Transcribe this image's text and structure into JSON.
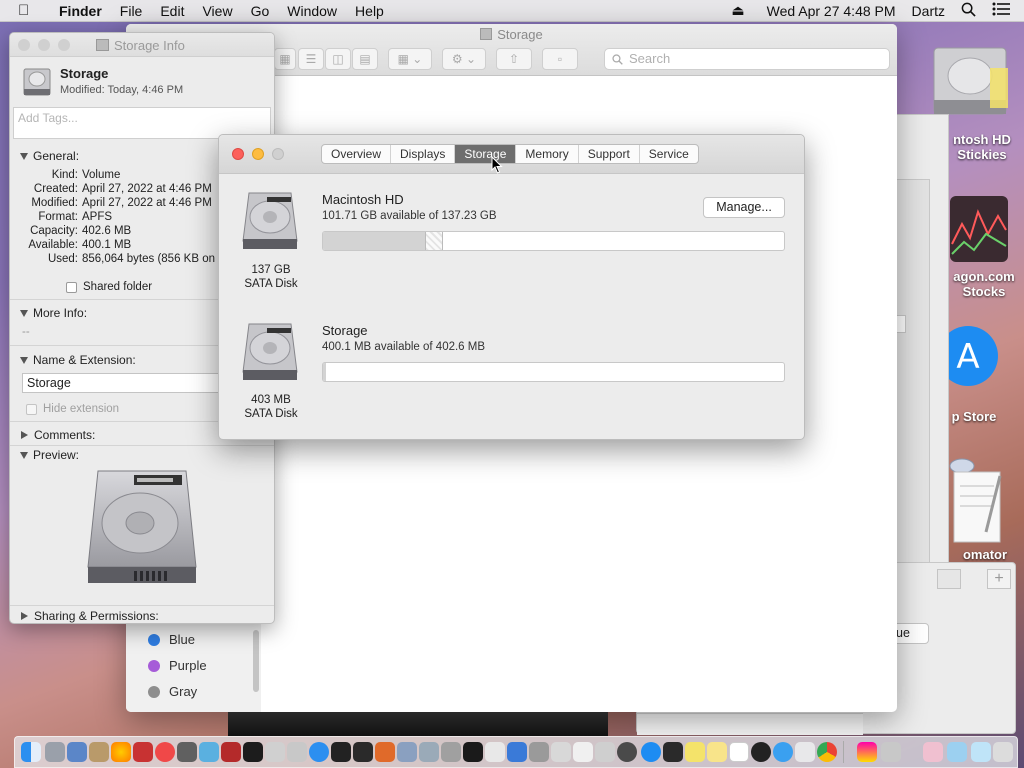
{
  "menubar": {
    "app": "Finder",
    "items": [
      "File",
      "Edit",
      "View",
      "Go",
      "Window",
      "Help"
    ],
    "datetime": "Wed Apr 27  4:48 PM",
    "user": "Dartz"
  },
  "desktop": {
    "icons": [
      {
        "label_line1": "ntosh HD",
        "label_line2": "Stickies"
      },
      {
        "label_line1": "agon.com",
        "label_line2": "Stocks"
      },
      {
        "label_line1": "p Store",
        "label_line2": ""
      },
      {
        "label_line1": "omator",
        "label_line2": ""
      }
    ]
  },
  "finder": {
    "title": "Storage",
    "search_placeholder": "Search",
    "tags": [
      {
        "label": "Blue",
        "color": "#2f7de1"
      },
      {
        "label": "Purple",
        "color": "#a65cd8"
      },
      {
        "label": "Gray",
        "color": "#8e8e8e"
      }
    ],
    "back_button_text": "ue"
  },
  "info": {
    "title": "Storage Info",
    "name": "Storage",
    "modified": "Modified: Today, 4:46 PM",
    "tags_placeholder": "Add Tags...",
    "general_label": "General:",
    "kind_k": "Kind:",
    "kind_v": "Volume",
    "created_k": "Created:",
    "created_v": "April 27, 2022 at 4:46 PM",
    "modified_k": "Modified:",
    "modified_v": "April 27, 2022 at 4:46 PM",
    "format_k": "Format:",
    "format_v": "APFS",
    "capacity_k": "Capacity:",
    "capacity_v": "402.6 MB",
    "available_k": "Available:",
    "available_v": "400.1 MB",
    "used_k": "Used:",
    "used_v": "856,064 bytes (856 KB on",
    "shared_folder": "Shared folder",
    "more_info_label": "More Info:",
    "more_info_value": "--",
    "name_ext_label": "Name & Extension:",
    "name_field": "Storage",
    "hide_extension": "Hide extension",
    "comments_label": "Comments:",
    "preview_label": "Preview:",
    "sharing_label": "Sharing & Permissions:"
  },
  "about": {
    "tabs": [
      "Overview",
      "Displays",
      "Storage",
      "Memory",
      "Support",
      "Service"
    ],
    "active_tab": "Storage",
    "disks": [
      {
        "name": "Macintosh HD",
        "available": "101.71 GB available of 137.23 GB",
        "size": "137 GB",
        "type": "SATA Disk",
        "used_fraction": 0.259
      },
      {
        "name": "Storage",
        "available": "400.1 MB available of 402.6 MB",
        "size": "403 MB",
        "type": "SATA Disk",
        "used_fraction": 0.006
      }
    ],
    "manage_button": "Manage..."
  },
  "colors": {
    "close": "#fc605b",
    "minimize": "#fdbc40",
    "zoom": "#34c84a",
    "inactive_light": "#d0d0d0"
  }
}
